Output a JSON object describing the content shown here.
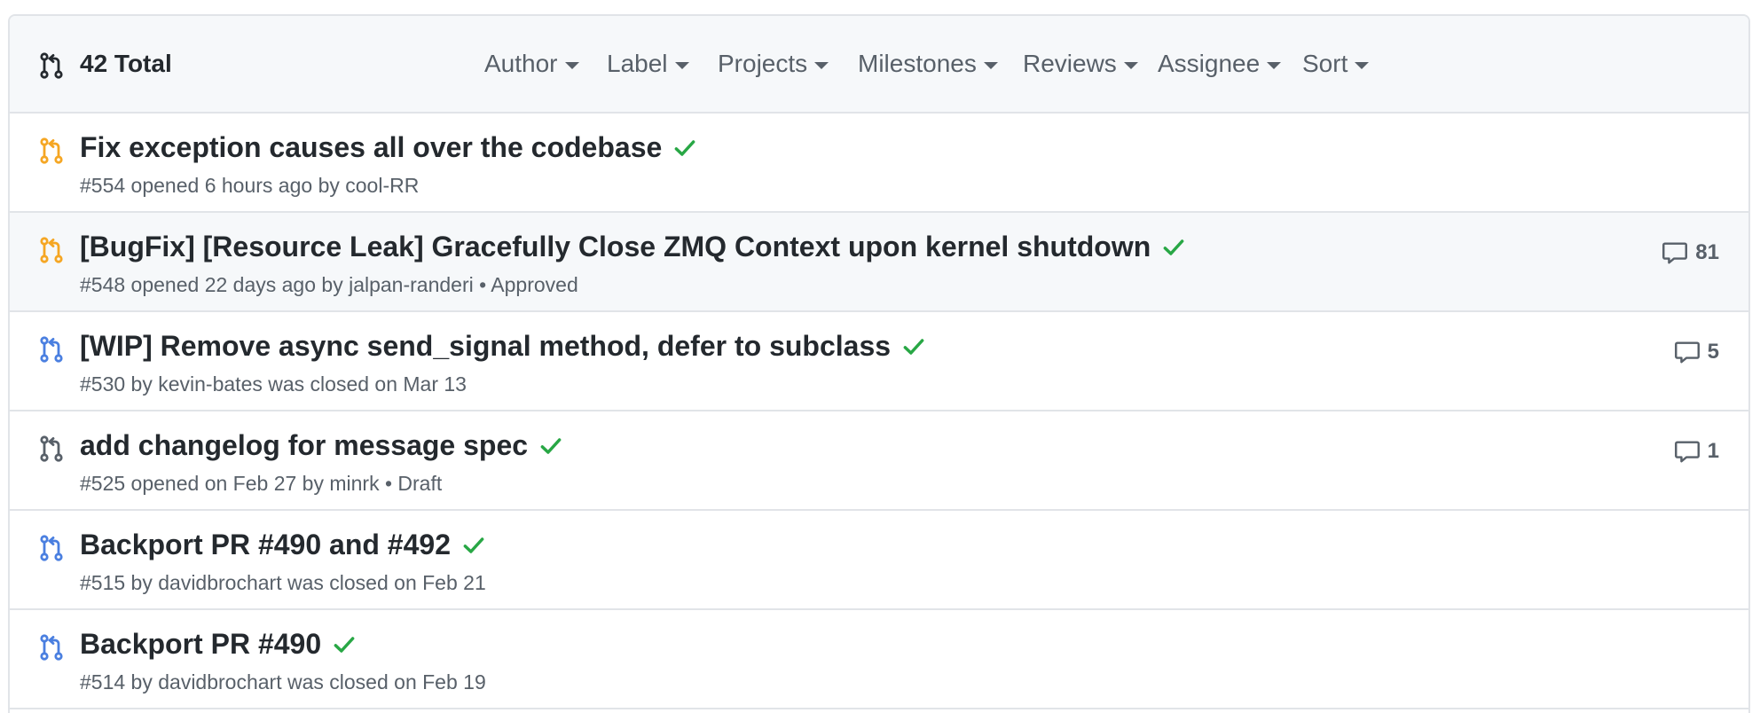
{
  "header": {
    "total_label": "42 Total",
    "filters": [
      "Author",
      "Label",
      "Projects",
      "Milestones",
      "Reviews",
      "Assignee",
      "Sort"
    ]
  },
  "colors": {
    "open_draft_icon": "#f5a623",
    "closed_icon": "#4a7fe0",
    "draft_icon": "#586069",
    "check": "#28a745",
    "meta_text": "#586069",
    "border": "#e1e4e8"
  },
  "pulls": [
    {
      "state": "open",
      "icon": "git-pull-request-icon",
      "title": "Fix exception causes all over the codebase",
      "status": "success",
      "meta": "#554 opened 6 hours ago by cool-RR",
      "comments": ""
    },
    {
      "state": "open",
      "icon": "git-pull-request-icon",
      "title": "[BugFix] [Resource Leak] Gracefully Close ZMQ Context upon kernel shutdown",
      "status": "success",
      "meta": "#548 opened 22 days ago by jalpan-randeri • Approved",
      "comments": "81"
    },
    {
      "state": "closed",
      "icon": "git-pull-request-icon",
      "title": "[WIP] Remove async send_signal method, defer to subclass",
      "status": "success",
      "meta": "#530 by kevin-bates was closed on Mar 13",
      "comments": "5"
    },
    {
      "state": "draft",
      "icon": "git-pull-request-icon",
      "title": "add changelog for message spec",
      "status": "success",
      "meta": "#525 opened on Feb 27 by minrk • Draft",
      "comments": "1"
    },
    {
      "state": "closed",
      "icon": "git-pull-request-icon",
      "title": "Backport PR #490 and #492",
      "status": "success",
      "meta": "#515 by davidbrochart was closed on Feb 21",
      "comments": ""
    },
    {
      "state": "closed",
      "icon": "git-pull-request-icon",
      "title": "Backport PR #490",
      "status": "success",
      "meta": "#514 by davidbrochart was closed on Feb 19",
      "comments": ""
    }
  ]
}
